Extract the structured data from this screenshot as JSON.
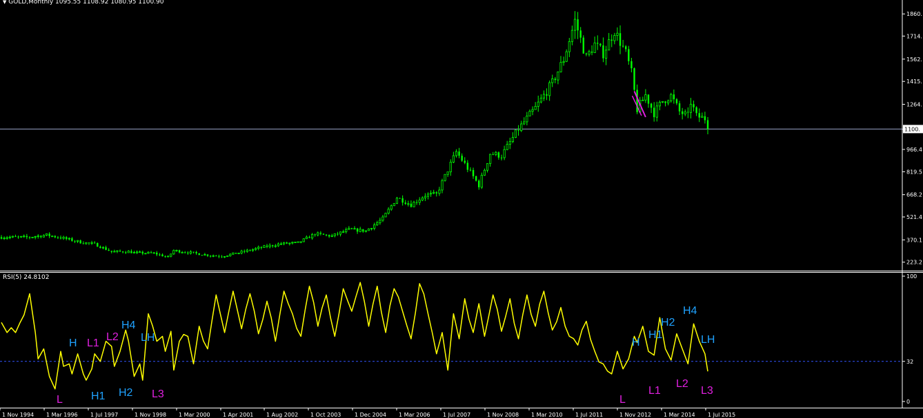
{
  "header": {
    "symbol": "GOLD,Monthly",
    "ohlc": "1095.55 1108.92 1080.95 1100.90",
    "rsi_label": "RSI(5) 24.8102"
  },
  "colors": {
    "background": "#000000",
    "bull_candle": "#00ff00",
    "bear_candle": "#00ff00",
    "rsi_line": "#ffff00",
    "level_line": "#3355ff",
    "price_line": "#9aa4c8",
    "annotation_high": "#1fa2ff",
    "annotation_low": "#e020e0",
    "drawing": "#e020e0"
  },
  "chart_data": [
    {
      "type": "candlestick",
      "title": "GOLD,Monthly",
      "x_ticks": [
        "1 Nov 1994",
        "1 Mar 1996",
        "1 Jul 1997",
        "1 Nov 1998",
        "1 Mar 2000",
        "1 Apr 2001",
        "1 Aug 2002",
        "1 Oct 2003",
        "1 Dec 2004",
        "1 Mar 2006",
        "1 Jul 2007",
        "1 Nov 2008",
        "1 Mar 2010",
        "1 Jul 2011",
        "1 Nov 2012",
        "1 Mar 2014",
        "1 Jul 2015"
      ],
      "x_range": [
        "1994-09",
        "2015-07"
      ],
      "y_ticks": [
        "1860.",
        "1714.",
        "1562.",
        "1415.",
        "1264.",
        "1100.",
        "966.4",
        "819.5",
        "668.2",
        "521.4",
        "370.1",
        "223.2"
      ],
      "ylim": [
        190,
        1920
      ],
      "current_price": 1100.9,
      "current_price_label": "1100.",
      "price_path": [
        [
          "1994-09",
          388
        ],
        [
          "1995-06",
          387
        ],
        [
          "1996-01",
          402
        ],
        [
          "1996-06",
          385
        ],
        [
          "1997-01",
          355
        ],
        [
          "1997-06",
          342
        ],
        [
          "1997-12",
          292
        ],
        [
          "1998-06",
          293
        ],
        [
          "1998-08",
          285
        ],
        [
          "1999-03",
          282
        ],
        [
          "1999-08",
          256
        ],
        [
          "1999-10",
          300
        ],
        [
          "2000-03",
          288
        ],
        [
          "2000-09",
          272
        ],
        [
          "2001-03",
          262
        ],
        [
          "2001-09",
          285
        ],
        [
          "2002-05",
          320
        ],
        [
          "2002-12",
          345
        ],
        [
          "2003-06",
          350
        ],
        [
          "2003-12",
          410
        ],
        [
          "2004-06",
          395
        ],
        [
          "2004-12",
          438
        ],
        [
          "2005-06",
          430
        ],
        [
          "2005-12",
          510
        ],
        [
          "2006-05",
          650
        ],
        [
          "2006-10",
          602
        ],
        [
          "2007-03",
          665
        ],
        [
          "2007-07",
          670
        ],
        [
          "2008-02",
          950
        ],
        [
          "2008-05",
          870
        ],
        [
          "2008-10",
          730
        ],
        [
          "2009-02",
          940
        ],
        [
          "2009-06",
          925
        ],
        [
          "2009-12",
          1100
        ],
        [
          "2010-06",
          1240
        ],
        [
          "2010-12",
          1405
        ],
        [
          "2011-04",
          1560
        ],
        [
          "2011-08",
          1815
        ],
        [
          "2011-12",
          1570
        ],
        [
          "2012-03",
          1660
        ],
        [
          "2012-06",
          1600
        ],
        [
          "2012-10",
          1750
        ],
        [
          "2013-02",
          1600
        ],
        [
          "2013-04",
          1470
        ],
        [
          "2013-06",
          1230
        ],
        [
          "2013-09",
          1325
        ],
        [
          "2013-12",
          1205
        ],
        [
          "2014-03",
          1285
        ],
        [
          "2014-06",
          1320
        ],
        [
          "2014-09",
          1215
        ],
        [
          "2014-12",
          1185
        ],
        [
          "2015-01",
          1280
        ],
        [
          "2015-03",
          1185
        ],
        [
          "2015-06",
          1170
        ],
        [
          "2015-07",
          1100.9
        ]
      ],
      "trendline": [
        [
          "2013-05",
          1350
        ],
        [
          "2013-09",
          1180
        ]
      ]
    },
    {
      "type": "line",
      "title": "RSI(5) 24.8102",
      "y_ticks": [
        "100",
        "32",
        "0"
      ],
      "ylim": [
        0,
        100
      ],
      "level": 32,
      "x": [
        "1994-09",
        "1994-11",
        "1995-02",
        "1995-05",
        "1995-07",
        "1995-09",
        "1995-10",
        "1995-12",
        "1996-02",
        "1996-04",
        "1996-06",
        "1996-07",
        "1996-09",
        "1996-10",
        "1996-12",
        "1997-02",
        "1997-03",
        "1997-05",
        "1997-06",
        "1997-08",
        "1997-10",
        "1997-12",
        "1998-01",
        "1998-03",
        "1998-05",
        "1998-06",
        "1998-08",
        "1998-10",
        "1998-11",
        "1999-01",
        "1999-04",
        "1999-06",
        "1999-07",
        "1999-09",
        "1999-10",
        "1999-12",
        "2000-03",
        "2000-05",
        "2000-07",
        "2000-10",
        "2001-01",
        "2001-04",
        "2001-07",
        "2001-10",
        "2002-01",
        "2002-04",
        "2002-07",
        "2002-10",
        "2003-01",
        "2003-04",
        "2003-07",
        "2003-10",
        "2004-01",
        "2004-04",
        "2004-07",
        "2004-10",
        "2005-01",
        "2005-04",
        "2005-07",
        "2005-10",
        "2006-01",
        "2006-04",
        "2006-07",
        "2006-10",
        "2007-01",
        "2007-04",
        "2007-07",
        "2007-09",
        "2007-11",
        "2008-01",
        "2008-03",
        "2008-05",
        "2008-08",
        "2008-10",
        "2008-12",
        "2009-03",
        "2009-06",
        "2009-09",
        "2009-12",
        "2010-03",
        "2010-06",
        "2010-09",
        "2010-12",
        "2011-03",
        "2011-06",
        "2011-09",
        "2011-12",
        "2012-03",
        "2012-06",
        "2012-09",
        "2012-11",
        "2013-01",
        "2013-03",
        "2013-05",
        "2013-06",
        "2013-08",
        "2013-10",
        "2013-12",
        "2014-02",
        "2014-04",
        "2014-06",
        "2014-08",
        "2014-10",
        "2014-12",
        "2015-02",
        "2015-04",
        "2015-06",
        "2015-07"
      ],
      "values": [
        63,
        55,
        55,
        69,
        86,
        55,
        34,
        42,
        20,
        10,
        40,
        28,
        30,
        22,
        38,
        22,
        17,
        26,
        38,
        32,
        48,
        44,
        28,
        40,
        57,
        48,
        20,
        30,
        17,
        70,
        48,
        52,
        40,
        56,
        25,
        48,
        52,
        30,
        60,
        42,
        85,
        55,
        88,
        58,
        86,
        54,
        80,
        48,
        88,
        70,
        52,
        92,
        60,
        85,
        52,
        90,
        72,
        95,
        60,
        92,
        55,
        90,
        72,
        50,
        94,
        70,
        38,
        55,
        25,
        70,
        50,
        82,
        55,
        78,
        52,
        85,
        56,
        82,
        50,
        85,
        60,
        88,
        57,
        75,
        52,
        45,
        64,
        40,
        30,
        22,
        40,
        26,
        34,
        52,
        47,
        60,
        40,
        37,
        67,
        42,
        33,
        54,
        42,
        30,
        62,
        48,
        38,
        24
      ]
    }
  ],
  "annotations": {
    "rsi_first": [
      {
        "text": "L",
        "kind": "low"
      },
      {
        "text": "H",
        "kind": "high"
      },
      {
        "text": "L1",
        "kind": "low"
      },
      {
        "text": "H1",
        "kind": "high"
      },
      {
        "text": "L2",
        "kind": "low"
      },
      {
        "text": "H2",
        "kind": "high"
      },
      {
        "text": "H4",
        "kind": "high"
      },
      {
        "text": "LH",
        "kind": "high"
      },
      {
        "text": "L3",
        "kind": "low"
      }
    ],
    "rsi_second": [
      {
        "text": "L",
        "kind": "low"
      },
      {
        "text": "H",
        "kind": "high"
      },
      {
        "text": "L1",
        "kind": "low"
      },
      {
        "text": "H1",
        "kind": "high"
      },
      {
        "text": "H2",
        "kind": "high"
      },
      {
        "text": "L2",
        "kind": "low"
      },
      {
        "text": "H4",
        "kind": "high"
      },
      {
        "text": "LH",
        "kind": "high"
      },
      {
        "text": "L3",
        "kind": "low"
      }
    ]
  }
}
